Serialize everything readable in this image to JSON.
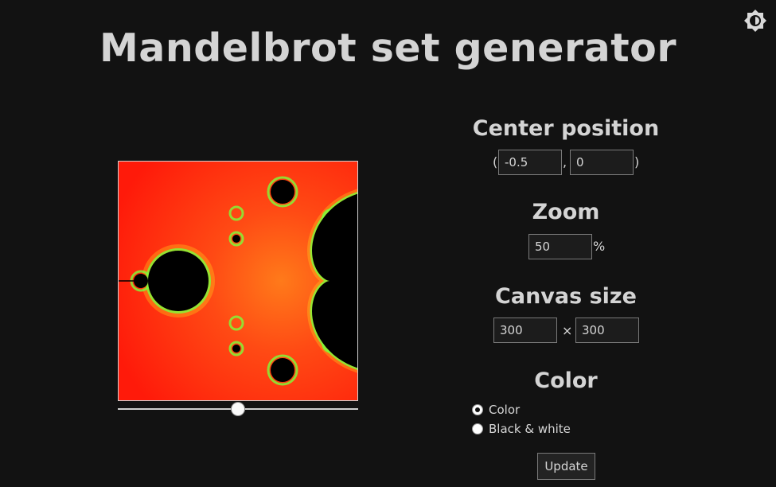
{
  "page": {
    "title": "Mandelbrot set generator"
  },
  "theme_toggle": {
    "icon": "brightness-contrast-icon"
  },
  "render": {
    "slider_fraction": 0.5
  },
  "center": {
    "heading": "Center position",
    "open_paren": "(",
    "comma": ",",
    "close_paren": ")",
    "x_value": "-0.5",
    "y_value": "0"
  },
  "zoom": {
    "heading": "Zoom",
    "value": "50",
    "unit": "%"
  },
  "canvas_size": {
    "heading": "Canvas size",
    "width": "300",
    "times": "×",
    "height": "300"
  },
  "color": {
    "heading": "Color",
    "options": [
      {
        "label": "Color",
        "checked": true
      },
      {
        "label": "Black & white",
        "checked": false
      }
    ]
  },
  "actions": {
    "update_label": "Update"
  }
}
